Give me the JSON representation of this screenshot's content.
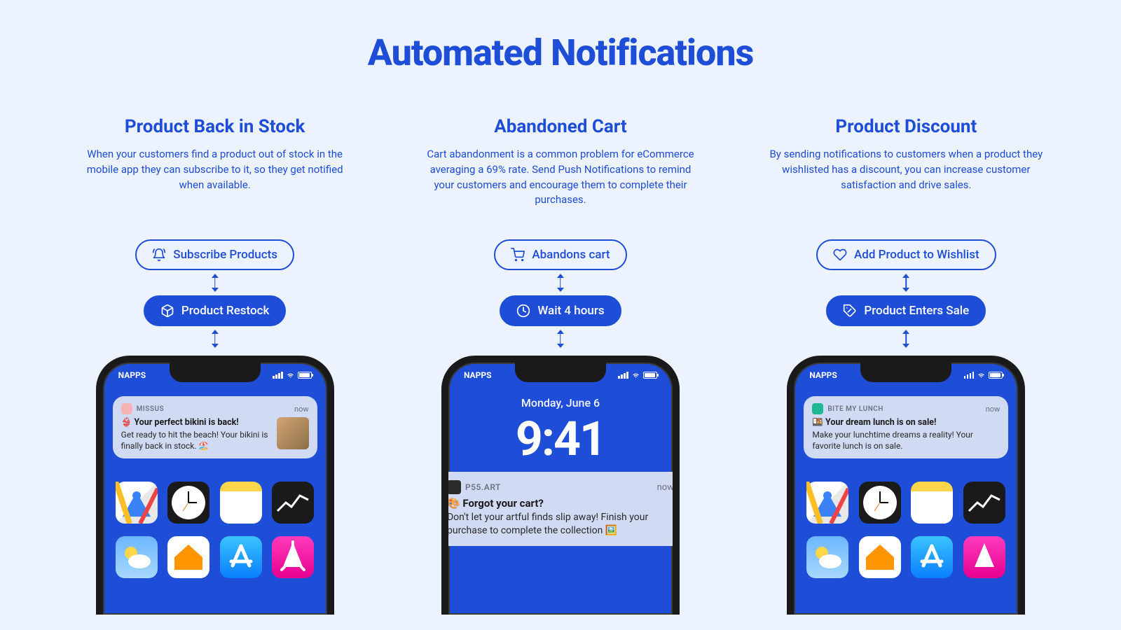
{
  "title": "Automated Notifications",
  "carrier": "NAPPS",
  "columns": [
    {
      "heading": "Product Back in Stock",
      "description": "When your customers find a product out of stock in the mobile app they can subscribe to it, so they get notified when available.",
      "pill1": "Subscribe Products",
      "pill2": "Product Restock",
      "phone_type": "home",
      "notification": {
        "app": "MISSUS",
        "time": "now",
        "title": "👙 Your perfect bikini is back!",
        "message": "Get ready to hit the beach! Your bikini is finally back in stock. 🏖️",
        "has_image": true,
        "icon_color": "#f8b4b4"
      }
    },
    {
      "heading": "Abandoned Cart",
      "description": "Cart abandonment is a common problem for eCommerce averaging a 69% rate. Send Push Notifications to remind your customers and encourage them to complete their purchases.",
      "pill1": "Abandons cart",
      "pill2": "Wait 4 hours",
      "phone_type": "lock",
      "lock": {
        "date": "Monday, June 6",
        "time": "9:41"
      },
      "notification": {
        "app": "P55.ART",
        "time": "now",
        "title": "🎨 Forgot your cart?",
        "message": "Don't let your artful finds slip away! Finish your purchase to complete the collection 🖼️",
        "has_image": false,
        "icon_color": "#2a2a2a"
      }
    },
    {
      "heading": "Product Discount",
      "description": "By sending notifications to customers when a product they wishlisted has a discount, you can increase customer satisfaction and drive sales.",
      "pill1": "Add Product to Wishlist",
      "pill2": "Product Enters Sale",
      "phone_type": "home",
      "notification": {
        "app": "BITE MY LUNCH",
        "time": "now",
        "title": "🍱 Your dream lunch is on sale!",
        "message": "Make your lunchtime dreams a reality! Your favorite lunch is on sale.",
        "has_image": false,
        "icon_color": "#1fb894"
      }
    }
  ],
  "icons": {
    "col0_pill1": "bell-icon",
    "col0_pill2": "box-icon",
    "col1_pill1": "cart-icon",
    "col1_pill2": "clock-icon",
    "col2_pill1": "heart-icon",
    "col2_pill2": "tag-icon"
  }
}
